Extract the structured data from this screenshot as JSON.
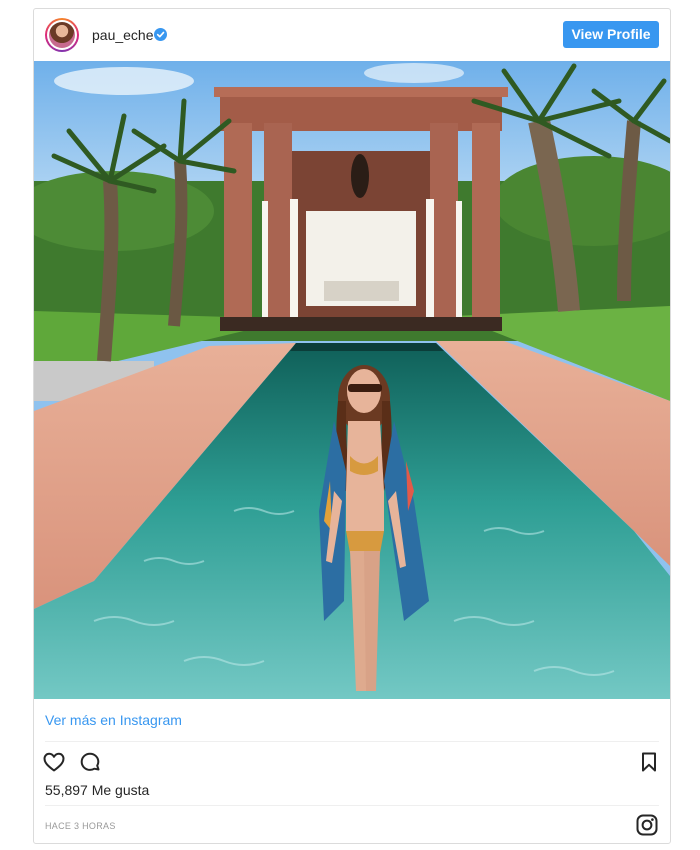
{
  "post": {
    "username": "pau_eche",
    "view_profile_label": "View Profile",
    "ver_mas_label": "Ver más en Instagram",
    "likes_text": "55,897 Me gusta",
    "timestamp": "HACE 3 HORAS"
  },
  "icons": {
    "avatar": "profile-avatar",
    "verified": "verified-badge-icon",
    "like": "heart-icon",
    "comment": "comment-bubble-icon",
    "save": "bookmark-icon",
    "brand": "instagram-logo-icon"
  },
  "colors": {
    "accent": "#3897f0",
    "text": "#262626",
    "muted": "#999999",
    "border": "#dbdbdb"
  }
}
